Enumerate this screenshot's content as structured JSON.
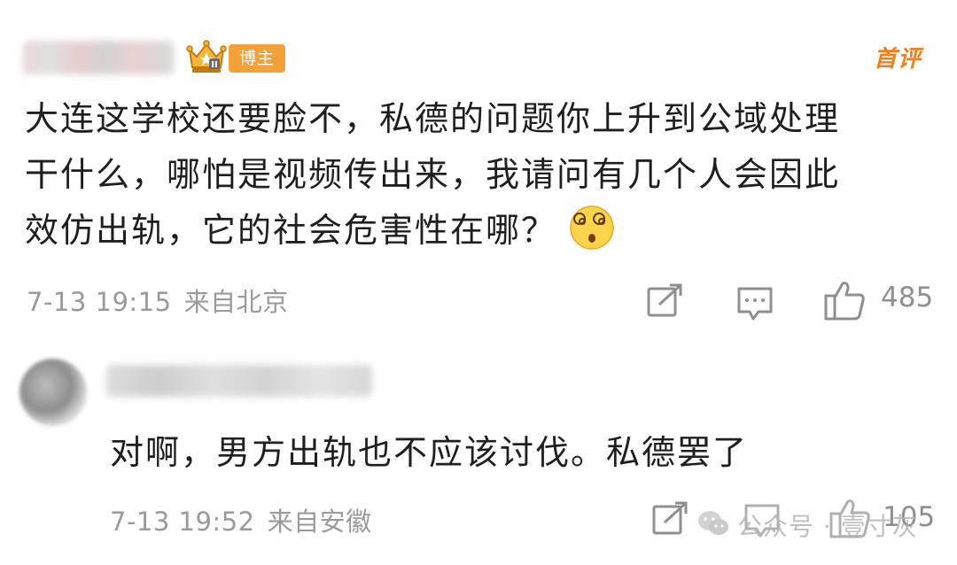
{
  "main_comment": {
    "badge_label": "博主",
    "first_comment_tag": "首评",
    "text_lines": [
      "大连这学校还要脸不，私德的问题你上升到公域处理",
      "干什么，哪怕是视频传出来，我请问有几个人会因此",
      "效仿出轨，它的社会危害性在哪？"
    ],
    "emoji": "dizzy-face",
    "timestamp": "7-13 19:15",
    "location": "来自北京",
    "like_count": "485"
  },
  "reply": {
    "text": "对啊，男方出轨也不应该讨伐。私德罢了",
    "timestamp": "7-13 19:52",
    "location": "来自安徽",
    "like_count": "105"
  },
  "watermark": {
    "text": "公众号 · 壹寸灰"
  },
  "colors": {
    "badge_bg": "#f3a23a",
    "first_comment": "#f0801c",
    "meta_text": "#9a9a9a"
  }
}
